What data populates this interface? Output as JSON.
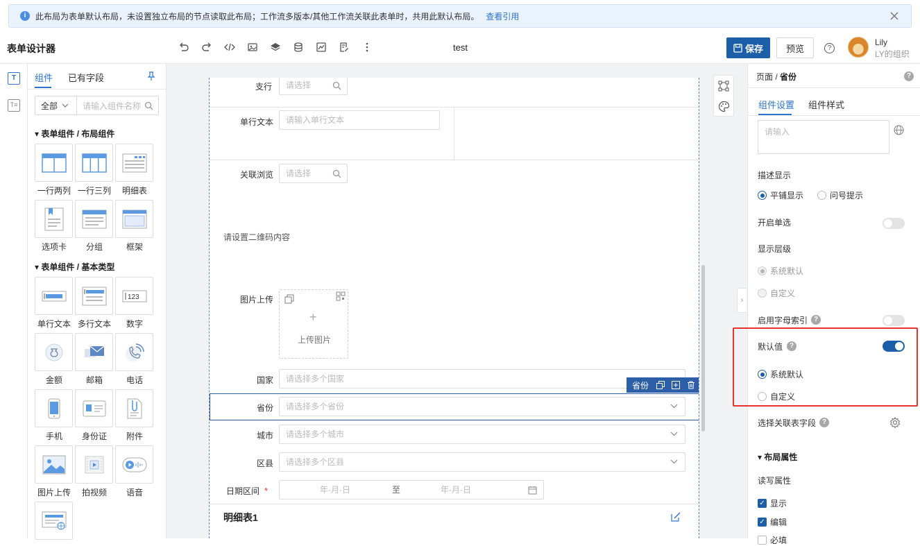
{
  "banner": {
    "message": "此布局为表单默认布局，未设置独立布局的节点读取此布局；工作流多版本/其他工作流关联此表单时，共用此默认布局。",
    "link": "查看引用"
  },
  "header": {
    "title": "表单设计器",
    "form_name": "test",
    "save_label": "保存",
    "preview_label": "预览",
    "user_name": "Lily",
    "user_org": "LY的组织"
  },
  "palette": {
    "tabs": [
      "组件",
      "已有字段"
    ],
    "filter_select": "全部",
    "search_placeholder": "请输入组件名称",
    "category_layout": "表单组件 / 布局组件",
    "category_basic": "表单组件 / 基本类型",
    "layout_items": [
      "一行两列",
      "一行三列",
      "明细表",
      "选项卡",
      "分组",
      "框架"
    ],
    "basic_items": [
      "单行文本",
      "多行文本",
      "数字",
      "金额",
      "邮箱",
      "电话",
      "手机",
      "身份证",
      "附件",
      "图片上传",
      "拍视频",
      "语音"
    ]
  },
  "form": {
    "fields": {
      "branch": {
        "label": "支行",
        "placeholder": "请选择"
      },
      "single_text": {
        "label": "单行文本",
        "placeholder": "请输入单行文本"
      },
      "related_browse": {
        "label": "关联浏览",
        "placeholder": "请选择"
      },
      "qrcode_hint": "请设置二维码内容",
      "image_upload": {
        "label": "图片上传",
        "button": "上传图片",
        "plus": "+"
      },
      "country": {
        "label": "国家",
        "placeholder": "请选择多个国家"
      },
      "province": {
        "label": "省份",
        "placeholder": "请选择多个省份"
      },
      "city": {
        "label": "城市",
        "placeholder": "请选择多个城市"
      },
      "district": {
        "label": "区县",
        "placeholder": "请选择多个区县"
      },
      "date_range": {
        "label": "日期区间",
        "required_mark": "*",
        "start": "年-月-日",
        "sep": "至",
        "end": "年-月-日"
      },
      "detail_table": "明细表1"
    },
    "selected_toolbar_label": "省份"
  },
  "right_panel": {
    "breadcrumb_root": "页面",
    "breadcrumb_sep": " / ",
    "breadcrumb_current": "省份",
    "tabs": [
      "组件设置",
      "组件样式"
    ],
    "textarea_placeholder": "请输入",
    "desc_display_label": "描述显示",
    "desc_options": [
      "平铺显示",
      "问号提示"
    ],
    "single_select_label": "开启单选",
    "display_level_label": "显示层级",
    "display_level_options": [
      "系统默认",
      "自定义"
    ],
    "letter_index_label": "启用字母索引",
    "default_value_label": "默认值",
    "default_value_options": [
      "系统默认",
      "自定义"
    ],
    "related_field_label": "选择关联表字段",
    "layout_section": "布局属性",
    "rw_label": "读写属性",
    "rw_options": [
      "显示",
      "编辑",
      "必填"
    ],
    "help_glyph": "?"
  },
  "rail": {
    "components_glyph": "T",
    "fields_glyph": "T≡"
  },
  "expander_glyph": "›",
  "colors": {
    "primary": "#1c5ea8",
    "link": "#2d74cf",
    "highlight_box": "#e8322e",
    "banner_bg": "#eaf3fd"
  }
}
